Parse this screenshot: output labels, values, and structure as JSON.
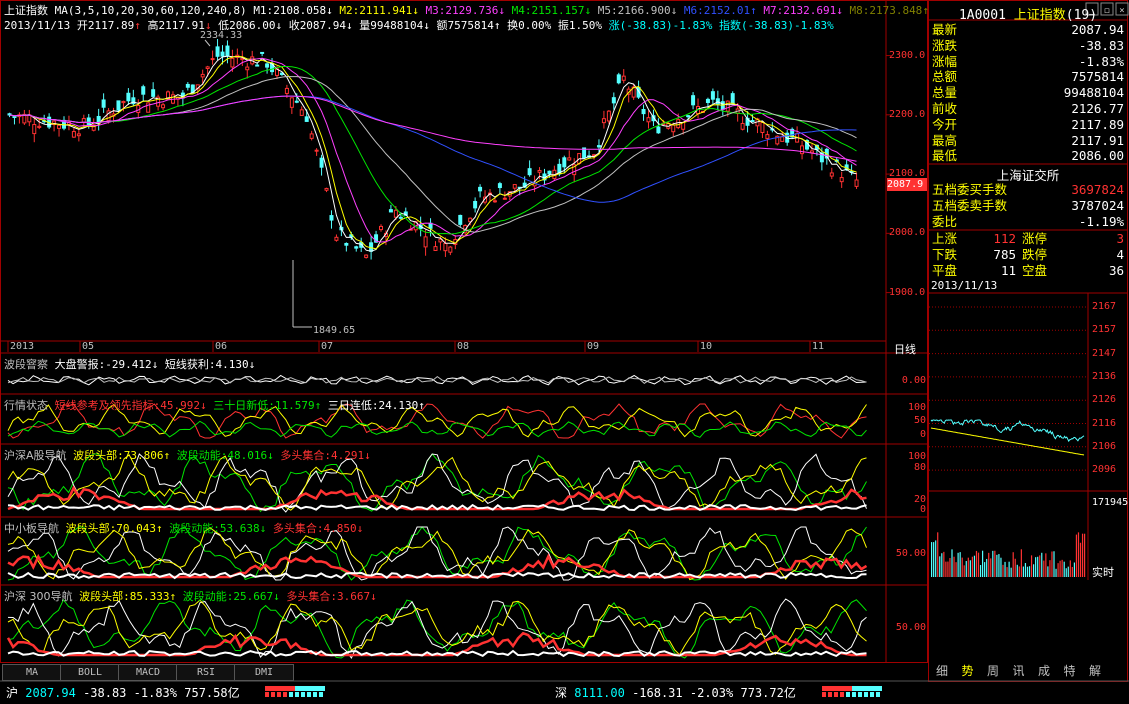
{
  "header": {
    "index_name": "上证指数",
    "ma_params": "MA(3,5,10,20,30,60,120,240,8)",
    "ma_values": [
      {
        "label": "M1:",
        "value": "2108.058",
        "arrow": "↓",
        "color": "#ffffff"
      },
      {
        "label": "M2:",
        "value": "2111.941",
        "arrow": "↓",
        "color": "#ffff00"
      },
      {
        "label": "M3:",
        "value": "2129.736",
        "arrow": "↓",
        "color": "#ff40ff"
      },
      {
        "label": "M4:",
        "value": "2151.157",
        "arrow": "↓",
        "color": "#00e600"
      },
      {
        "label": "M5:",
        "value": "2166.900",
        "arrow": "↓",
        "color": "#c0c0c0"
      },
      {
        "label": "M6:",
        "value": "2152.01",
        "arrow": "↑",
        "color": "#3050ff"
      },
      {
        "label": "M7:",
        "value": "2132.691",
        "arrow": "↓",
        "color": "#ff40ff"
      },
      {
        "label": "M8:",
        "value": "2173.848",
        "arrow": "↑",
        "color": "#808000"
      }
    ],
    "date": "2013/11/13",
    "open_label": "开",
    "open_value": "2117.89",
    "open_arrow": "↑",
    "high_label": "高",
    "high_value": "2117.91",
    "high_arrow": "↓",
    "low_label": "低",
    "low_value": "2086.00",
    "low_arrow": "↓",
    "close_label": "收",
    "close_value": "2087.94",
    "close_arrow": "↓",
    "vol_label": "量",
    "vol_value": "99488104",
    "vol_arrow": "↓",
    "amt_label": "额",
    "amt_value": "7575814",
    "amt_arrow": "↑",
    "turnover": "换0.00%",
    "amplitude": "振1.50%",
    "change": "涨(-38.83)-1.83%",
    "index_change": "指数(-38.83)-1.83%"
  },
  "main_chart": {
    "y_ticks": [
      "2300.0",
      "2200.0",
      "2100.0",
      "2000.0",
      "1900.0"
    ],
    "high_mark": "2334.33",
    "low_mark": "1849.65",
    "last_price_tag": "2087.9",
    "x_ticks": [
      "2013",
      "05",
      "06",
      "07",
      "08",
      "09",
      "10",
      "11"
    ],
    "period_label": "日线"
  },
  "indicators": [
    {
      "name": "波段窨察",
      "items": [
        {
          "text": "大盘警报:-29.412",
          "arrow": "↓",
          "color": "#ffffff"
        },
        {
          "text": "短线获利:4.130",
          "arrow": "↓",
          "color": "#ffffff"
        }
      ],
      "axis": [
        "0.00"
      ]
    },
    {
      "name": "行情状态",
      "items": [
        {
          "text": "短线参考及领先指标:45.992",
          "arrow": "↓",
          "color": "#ff3232"
        },
        {
          "text": "三十日新低:11.579",
          "arrow": "↑",
          "color": "#00e600"
        },
        {
          "text": "三日连低:24.130",
          "arrow": "↑",
          "color": "#ffffff"
        }
      ],
      "axis": [
        "100",
        "50",
        "0"
      ]
    },
    {
      "name": "沪深A股导航",
      "items": [
        {
          "text": "波段头部:73.806",
          "arrow": "↑",
          "color": "#ffff00"
        },
        {
          "text": "波段动能:48.016",
          "arrow": "↓",
          "color": "#00e600"
        },
        {
          "text": "多头集合:4.291",
          "arrow": "↓",
          "color": "#ff3232"
        }
      ],
      "axis": [
        "100",
        "80",
        "20",
        "0"
      ]
    },
    {
      "name": "中小板导航",
      "items": [
        {
          "text": "波段头部:70.043",
          "arrow": "↑",
          "color": "#ffff00"
        },
        {
          "text": "波段动能:53.638",
          "arrow": "↓",
          "color": "#00e600"
        },
        {
          "text": "多头集合:4.850",
          "arrow": "↓",
          "color": "#ff3232"
        }
      ],
      "axis": [
        "50.00"
      ]
    },
    {
      "name": "沪深 300导航",
      "items": [
        {
          "text": "波段头部:85.333",
          "arrow": "↑",
          "color": "#ffff00"
        },
        {
          "text": "波段动能:25.667",
          "arrow": "↓",
          "color": "#00e600"
        },
        {
          "text": "多头集合:3.667",
          "arrow": "↓",
          "color": "#ff3232"
        }
      ],
      "axis": [
        "50.00"
      ]
    }
  ],
  "bottom_tabs": [
    "MA",
    "BOLL",
    "MACD",
    "RSI",
    "DMI"
  ],
  "right_panel": {
    "code": "1A0001",
    "name": "上证指数",
    "count": "(19)",
    "quotes": [
      {
        "label": "最新",
        "value": "2087.94",
        "color": "#ffffff"
      },
      {
        "label": "涨跌",
        "value": "-38.83",
        "color": "#ffffff"
      },
      {
        "label": "涨幅",
        "value": "-1.83%",
        "color": "#ffffff"
      },
      {
        "label": "总额",
        "value": "7575814",
        "color": "#ffffff"
      },
      {
        "label": "总量",
        "value": "99488104",
        "color": "#ffffff"
      },
      {
        "label": "前收",
        "value": "2126.77",
        "color": "#ffffff"
      },
      {
        "label": "今开",
        "value": "2117.89",
        "color": "#ffffff"
      },
      {
        "label": "最高",
        "value": "2117.91",
        "color": "#ffffff"
      },
      {
        "label": "最低",
        "value": "2086.00",
        "color": "#ffffff"
      }
    ],
    "exchange": "上海证交所",
    "orders": [
      {
        "label": "五档委买手数",
        "value": "3697824",
        "color": "#ff3232"
      },
      {
        "label": "五档委卖手数",
        "value": "3787024",
        "color": "#ffffff"
      },
      {
        "label": "委比",
        "value": "-1.19%",
        "color": "#ffffff"
      }
    ],
    "breadth": [
      {
        "l1": "上涨",
        "v1": "112",
        "l2": "涨停",
        "v2": "3",
        "c1": "#ff3232",
        "c2": "#ff3232"
      },
      {
        "l1": "下跌",
        "v1": "785",
        "l2": "跌停",
        "v2": "4",
        "c1": "#ffffff",
        "c2": "#ffffff"
      },
      {
        "l1": "平盘",
        "v1": "11",
        "l2": "空盘",
        "v2": "36",
        "c1": "#ffffff",
        "c2": "#ffffff"
      }
    ],
    "mini_date": "2013/11/13",
    "mini_price_ticks": [
      "2167",
      "2157",
      "2147",
      "2136",
      "2126",
      "2116",
      "2106",
      "2096"
    ],
    "mini_vol_tick": "171945",
    "mini_label": "实时",
    "tabs": [
      "细",
      "势",
      "周",
      "讯",
      "成",
      "特",
      "解"
    ],
    "active_tab": "势"
  },
  "status_bar": {
    "sh_label": "沪",
    "sh_price": "2087.94",
    "sh_change": "-38.83",
    "sh_pct": "-1.83%",
    "sh_amount": "757.58亿",
    "sz_label": "深",
    "sz_price": "8111.00",
    "sz_change": "-168.31",
    "sz_pct": "-2.03%",
    "sz_amount": "773.72亿"
  },
  "colors": {
    "up": "#ff3232",
    "down": "#54ffff",
    "grid": "#a00000",
    "ma_white": "#ffffff"
  }
}
